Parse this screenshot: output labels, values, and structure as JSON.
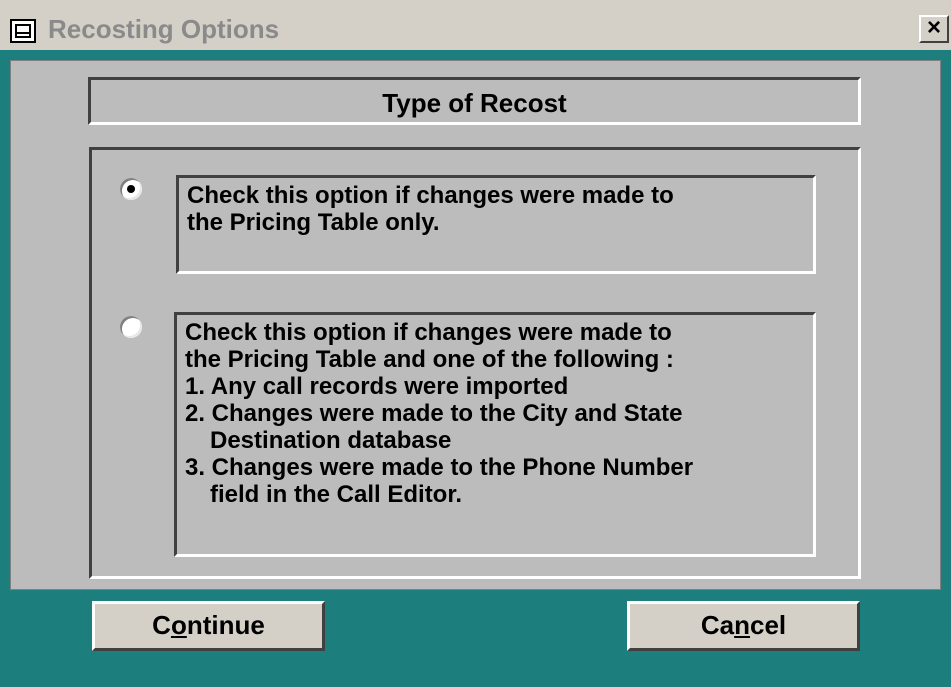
{
  "window": {
    "title": "Recosting Options",
    "close_label": "×",
    "icon": "form-icon"
  },
  "header": {
    "title": "Type of Recost"
  },
  "options": [
    {
      "selected": true,
      "lines": [
        "Check this option if changes were made to",
        "the Pricing Table only."
      ]
    },
    {
      "selected": false,
      "lines": [
        "Check this option if changes were made to",
        "the Pricing Table and one of the following :",
        "1. Any call records were imported",
        "2. Changes were made to the City and State",
        "Destination database",
        "3. Changes were made to the Phone Number",
        "field in the Call Editor."
      ]
    }
  ],
  "buttons": {
    "continue": {
      "pre": "C",
      "accel": "o",
      "post": "ntinue"
    },
    "cancel": {
      "pre": "Ca",
      "accel": "n",
      "post": "cel"
    }
  },
  "colors": {
    "frame": "#1d7f7d",
    "panel": "#bcbcbc",
    "button_face": "#d4d0c8",
    "title_text": "#8a8a8a"
  }
}
